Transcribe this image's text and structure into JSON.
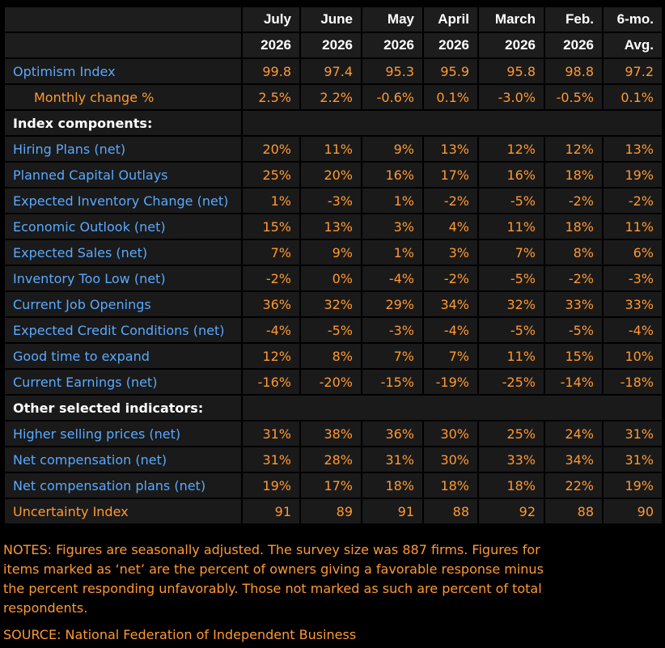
{
  "header": {
    "columns": [
      {
        "top": "July",
        "bottom": "2026"
      },
      {
        "top": "June",
        "bottom": "2026"
      },
      {
        "top": "May",
        "bottom": "2026"
      },
      {
        "top": "April",
        "bottom": "2026"
      },
      {
        "top": "March",
        "bottom": "2026"
      },
      {
        "top": "Feb.",
        "bottom": "2026"
      },
      {
        "top": "6-mo.",
        "bottom": "Avg."
      }
    ]
  },
  "rows": [
    {
      "type": "data",
      "label": "Optimism Index",
      "values": [
        "99.8",
        "97.4",
        "95.3",
        "95.9",
        "95.8",
        "98.8",
        "97.2"
      ]
    },
    {
      "type": "data",
      "style": "orange-indent",
      "label": "Monthly change %",
      "values": [
        "2.5%",
        "2.2%",
        "-0.6%",
        "0.1%",
        "-3.0%",
        "-0.5%",
        "0.1%"
      ]
    },
    {
      "type": "section",
      "label": "Index components:"
    },
    {
      "type": "data",
      "label": "Hiring Plans (net)",
      "values": [
        "20%",
        "11%",
        "9%",
        "13%",
        "12%",
        "12%",
        "13%"
      ]
    },
    {
      "type": "data",
      "label": "Planned Capital Outlays",
      "values": [
        "25%",
        "20%",
        "16%",
        "17%",
        "16%",
        "18%",
        "19%"
      ]
    },
    {
      "type": "data",
      "label": "Expected Inventory Change (net)",
      "values": [
        "1%",
        "-3%",
        "1%",
        "-2%",
        "-5%",
        "-2%",
        "-2%"
      ]
    },
    {
      "type": "data",
      "label": "Economic Outlook (net)",
      "values": [
        "15%",
        "13%",
        "3%",
        "4%",
        "11%",
        "18%",
        "11%"
      ]
    },
    {
      "type": "data",
      "label": "Expected Sales (net)",
      "values": [
        "7%",
        "9%",
        "1%",
        "3%",
        "7%",
        "8%",
        "6%"
      ]
    },
    {
      "type": "data",
      "label": "Inventory Too Low (net)",
      "values": [
        "-2%",
        "0%",
        "-4%",
        "-2%",
        "-5%",
        "-2%",
        "-3%"
      ]
    },
    {
      "type": "data",
      "label": "Current Job Openings",
      "values": [
        "36%",
        "32%",
        "29%",
        "34%",
        "32%",
        "33%",
        "33%"
      ]
    },
    {
      "type": "data",
      "label": "Expected Credit Conditions (net)",
      "values": [
        "-4%",
        "-5%",
        "-3%",
        "-4%",
        "-5%",
        "-5%",
        "-4%"
      ]
    },
    {
      "type": "data",
      "label": "Good time to expand",
      "values": [
        "12%",
        "8%",
        "7%",
        "7%",
        "11%",
        "15%",
        "10%"
      ]
    },
    {
      "type": "data",
      "label": "Current Earnings (net)",
      "values": [
        "-16%",
        "-20%",
        "-15%",
        "-19%",
        "-25%",
        "-14%",
        "-18%"
      ]
    },
    {
      "type": "section",
      "label": "Other selected indicators:"
    },
    {
      "type": "data",
      "label": "Higher selling prices (net)",
      "values": [
        "31%",
        "38%",
        "36%",
        "30%",
        "25%",
        "24%",
        "31%"
      ]
    },
    {
      "type": "data",
      "label": "Net compensation (net)",
      "values": [
        "31%",
        "28%",
        "31%",
        "30%",
        "33%",
        "34%",
        "31%"
      ]
    },
    {
      "type": "data",
      "label": "Net compensation plans (net)",
      "values": [
        "19%",
        "17%",
        "18%",
        "18%",
        "18%",
        "22%",
        "19%"
      ]
    },
    {
      "type": "data",
      "style": "orange",
      "label": "Uncertainty Index",
      "values": [
        "91",
        "89",
        "91",
        "88",
        "92",
        "88",
        "90"
      ]
    }
  ],
  "notes": "NOTES: Figures are seasonally adjusted. The survey size was 887 firms. Figures for items marked as ‘net’ are the percent of owners giving a favorable response minus the percent responding unfavorably. Those not marked as such are percent of total respondents.",
  "source": "SOURCE: National Federation of Independent Business",
  "colors": {
    "label_blue": "#5aa9ff",
    "value_orange": "#ff9933",
    "header_text": "#ffffff",
    "cell_bg": "#1a1a1a",
    "page_bg": "#000000"
  }
}
